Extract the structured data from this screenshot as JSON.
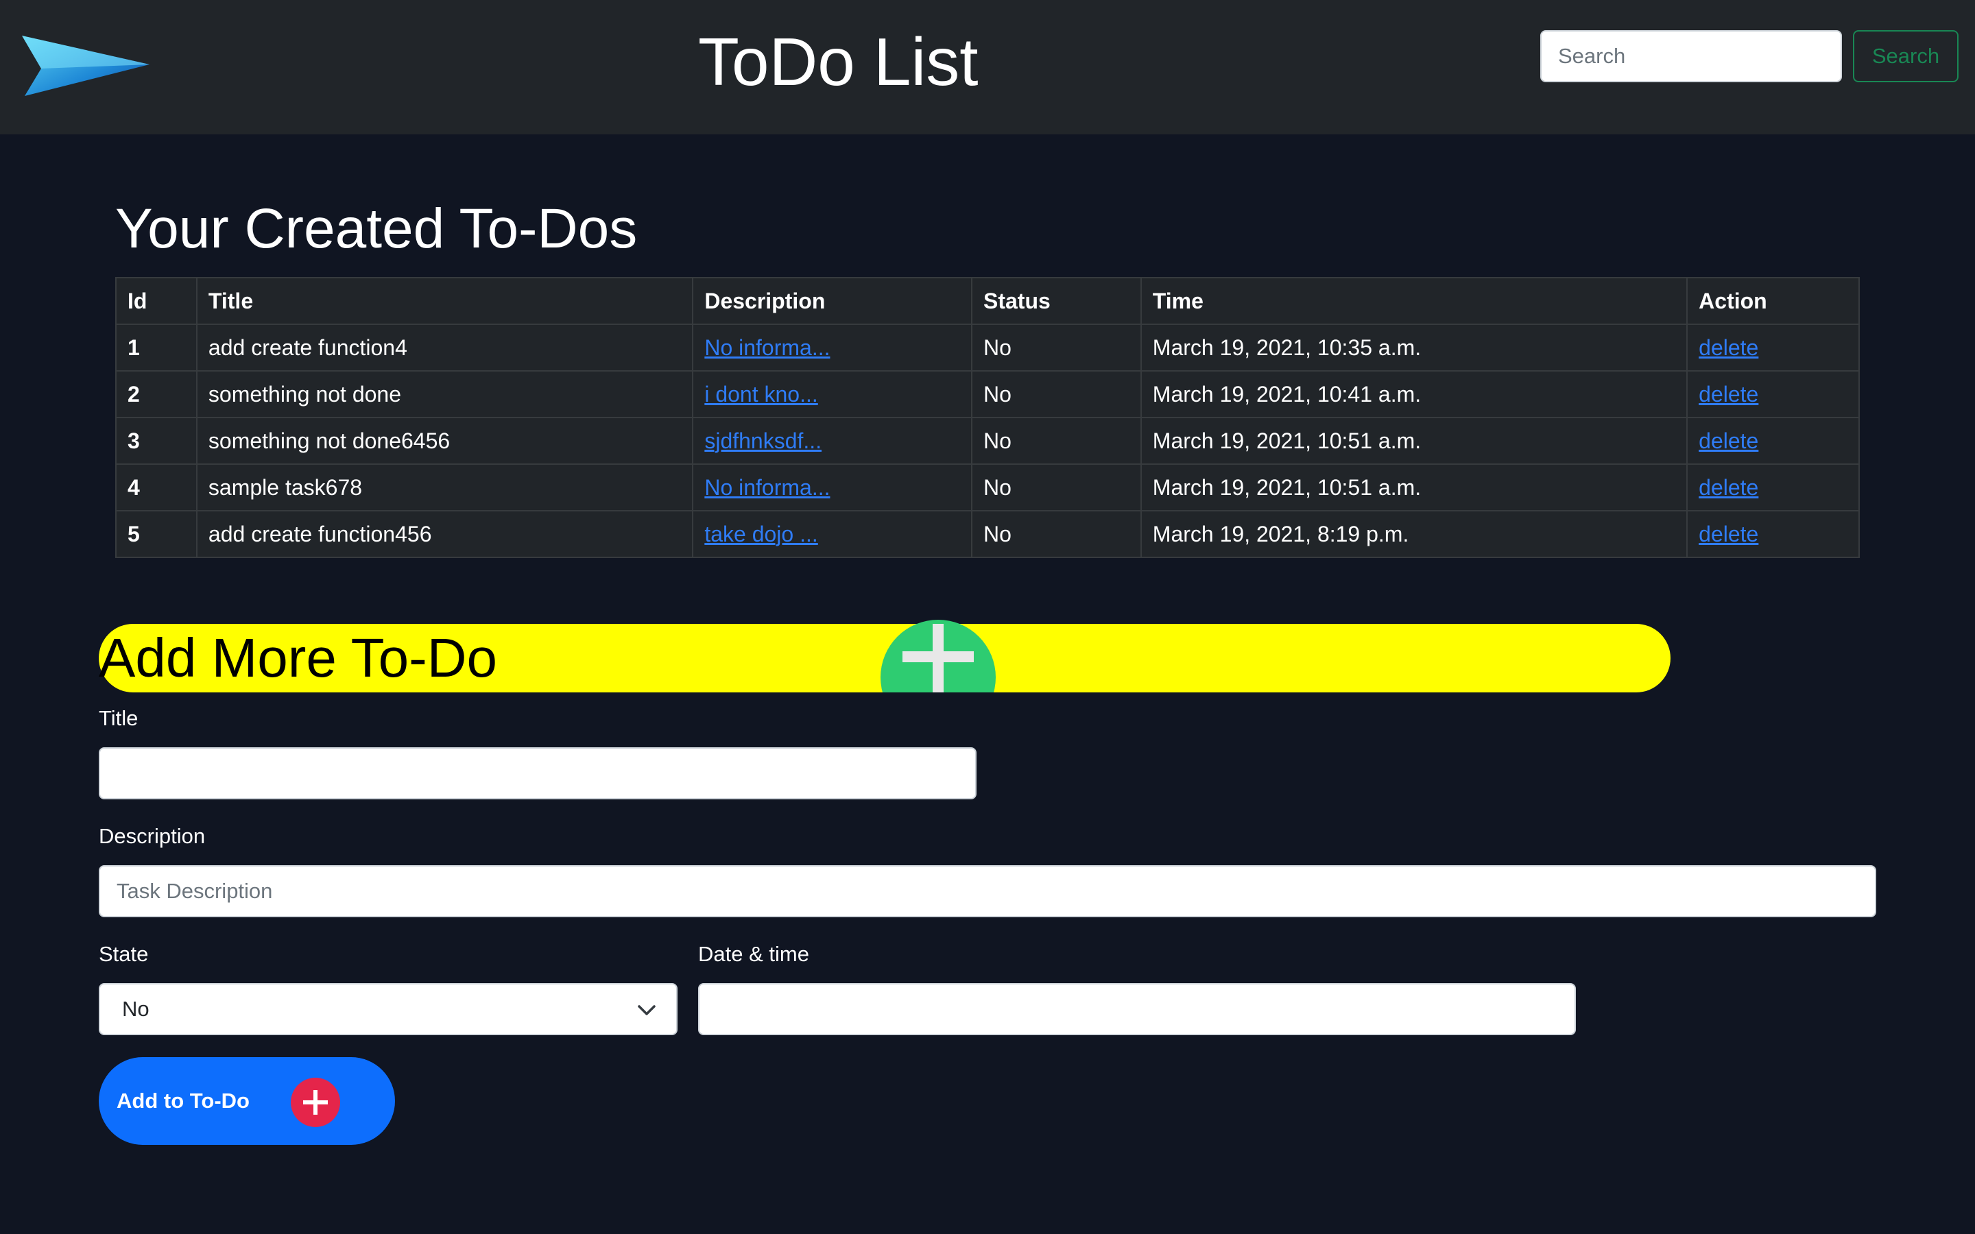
{
  "navbar": {
    "title": "ToDo List",
    "search": {
      "placeholder": "Search",
      "value": "",
      "button_label": "Search"
    }
  },
  "todos": {
    "heading": "Your Created To-Dos",
    "columns": [
      "Id",
      "Title",
      "Description",
      "Status",
      "Time",
      "Action"
    ],
    "rows": [
      {
        "id": "1",
        "title": "add create function4",
        "description": "No informa...",
        "status": "No",
        "time": "March 19, 2021, 10:35 a.m.",
        "action": "delete"
      },
      {
        "id": "2",
        "title": "something not done",
        "description": "i dont kno...",
        "status": "No",
        "time": "March 19, 2021, 10:41 a.m.",
        "action": "delete"
      },
      {
        "id": "3",
        "title": "something not done6456",
        "description": "sjdfhnksdf...",
        "status": "No",
        "time": "March 19, 2021, 10:51 a.m.",
        "action": "delete"
      },
      {
        "id": "4",
        "title": "sample task678",
        "description": "No informa...",
        "status": "No",
        "time": "March 19, 2021, 10:51 a.m.",
        "action": "delete"
      },
      {
        "id": "5",
        "title": "add create function456",
        "description": "take dojo ...",
        "status": "No",
        "time": "March 19, 2021, 8:19 p.m.",
        "action": "delete"
      }
    ]
  },
  "add_form": {
    "heading": "Add More To-Do",
    "title_label": "Title",
    "title_value": "",
    "description_label": "Description",
    "description_placeholder": "Task Description",
    "state_label": "State",
    "state_value": "No",
    "datetime_label": "Date & time",
    "datetime_value": "",
    "submit_label": "Add to To-Do"
  },
  "colors": {
    "page_bg": "#101522",
    "navbar_bg": "#212529",
    "banner_bg": "#ffff00",
    "banner_icon": "#2ecc71",
    "submit_bg": "#0d6efd",
    "submit_icon": "#e5254a",
    "link": "#2f7cf6",
    "search_button": "#198754"
  },
  "icons": {
    "brand": "paper-plane-logo",
    "banner": "plus-circle-icon",
    "submit": "plus-circle-icon",
    "select": "chevron-down-icon"
  }
}
